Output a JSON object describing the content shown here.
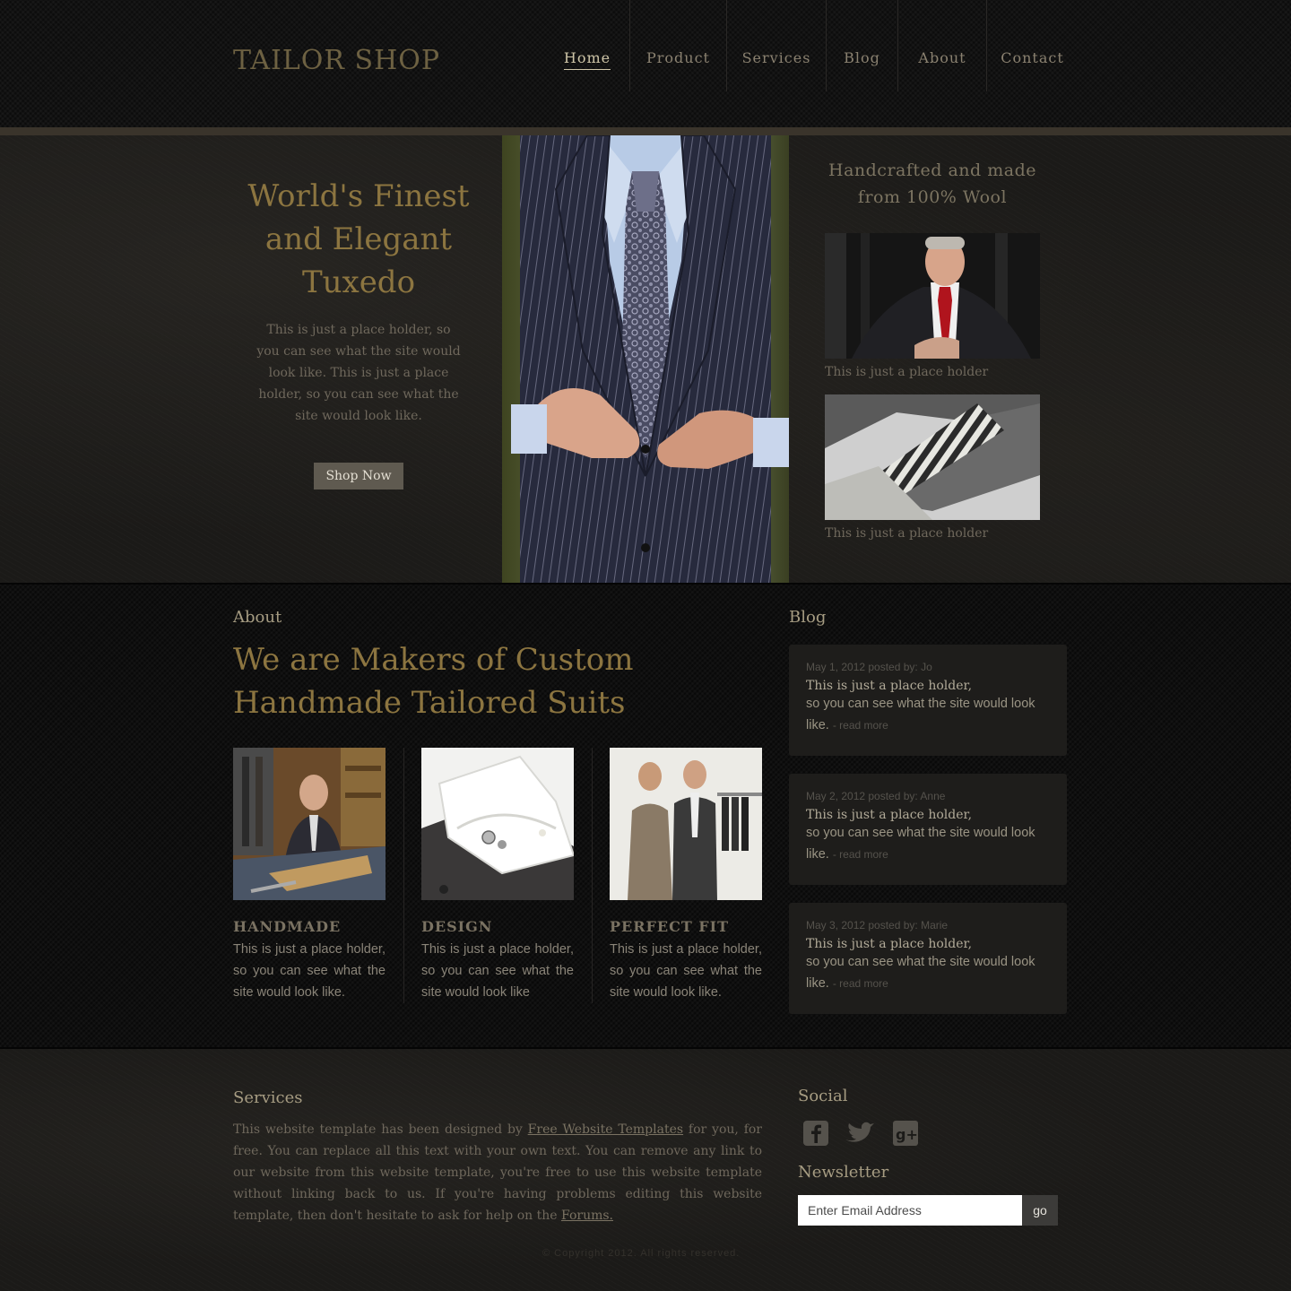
{
  "header": {
    "logo": "TAILOR SHOP",
    "nav": [
      {
        "label": "Home",
        "active": true
      },
      {
        "label": "Product",
        "active": false
      },
      {
        "label": "Services",
        "active": false
      },
      {
        "label": "Blog",
        "active": false
      },
      {
        "label": "About",
        "active": false
      },
      {
        "label": "Contact",
        "active": false
      }
    ]
  },
  "hero": {
    "title": "World's Finest and Elegant Tuxedo",
    "text": "This is just a place holder, so you can see what the site would look like. This is just a place holder, so you can see what the site would look like.",
    "button": "Shop Now",
    "side_title": "Handcrafted and made from 100% Wool",
    "side_items": [
      {
        "caption": "This is just a place holder"
      },
      {
        "caption": "This is just a place holder"
      }
    ]
  },
  "about": {
    "label": "About",
    "heading": "We are Makers of Custom Handmade Tailored Suits",
    "features": [
      {
        "title": "HANDMADE",
        "text": "This is just a place holder, so you can see what the site would look like."
      },
      {
        "title": "DESIGN",
        "text": "This is just a place holder, so you can see what the site would look like"
      },
      {
        "title": "PERFECT FIT",
        "text": "This is just a place holder, so you can see what the site would look like."
      }
    ]
  },
  "blog": {
    "label": "Blog",
    "posts": [
      {
        "meta": "May 1, 2012  posted by: Jo",
        "line1": "This is just a place holder,",
        "line2": "so you can see what the site would look like.",
        "read_more": "- read more"
      },
      {
        "meta": "May 2, 2012  posted by: Anne",
        "line1": "This is just a place holder,",
        "line2": "so you can see what the site would look like.",
        "read_more": "- read more"
      },
      {
        "meta": "May 3, 2012  posted by: Marie",
        "line1": "This is just a place holder,",
        "line2": "so you can see what the site would look like.",
        "read_more": "- read more"
      }
    ]
  },
  "footer": {
    "services_label": "Services",
    "services_text_1": "This website template has been designed by ",
    "services_link_1": "Free Website Templates",
    "services_text_2": " for you, for free. You can replace all this text with your own text. You can remove any link to our website from this website template, you're free to use this website template without linking back to us. If you're having problems editing this website template, then don't hesitate to ask for help on the ",
    "services_link_2": "Forums.",
    "social_label": "Social",
    "social_icons": [
      "facebook-icon",
      "twitter-icon",
      "google-plus-icon"
    ],
    "newsletter_label": "Newsletter",
    "email_placeholder": "Enter Email Address",
    "go_label": "go",
    "copyright": "© Copyright 2012. All rights reserved."
  }
}
